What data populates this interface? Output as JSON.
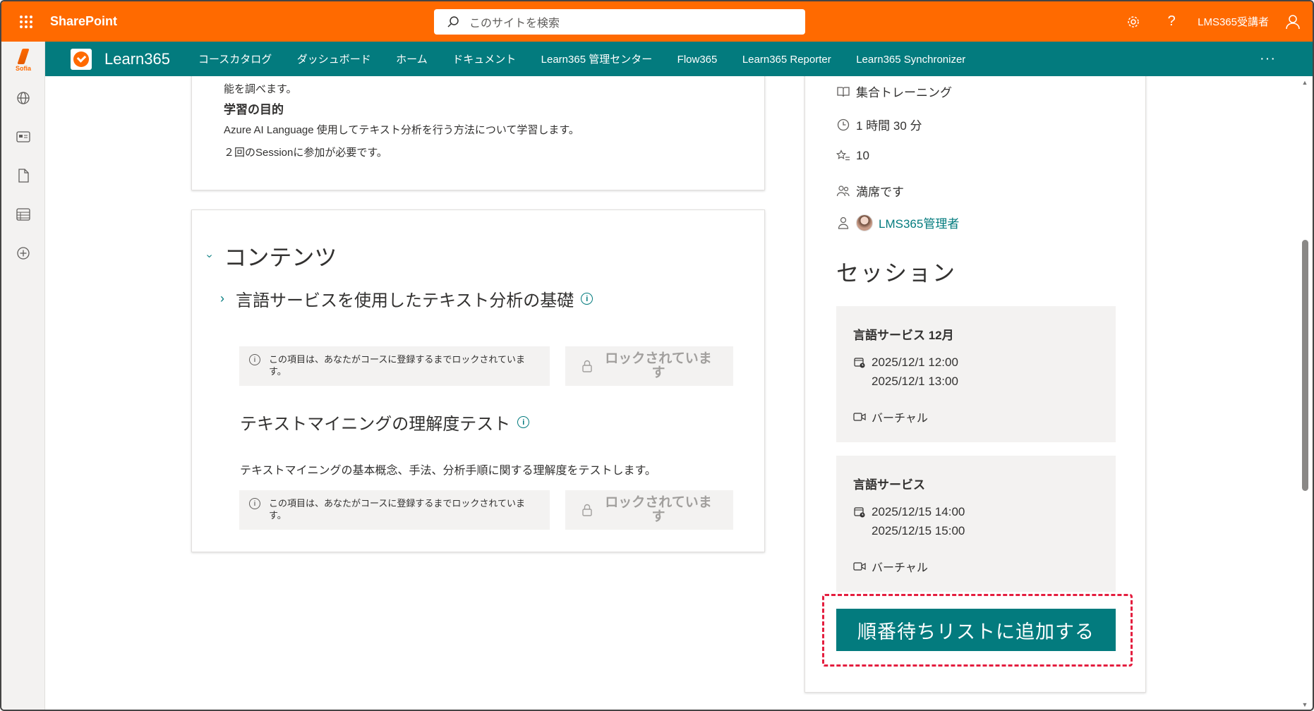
{
  "suite": {
    "app_name": "SharePoint",
    "search_placeholder": "このサイトを検索",
    "user_name": "LMS365受講者"
  },
  "rail": {
    "brand_text": "Sofia"
  },
  "site": {
    "title": "Learn365",
    "nav": [
      "コースカタログ",
      "ダッシュボード",
      "ホーム",
      "ドキュメント",
      "Learn365 管理センター",
      "Flow365",
      "Learn365 Reporter",
      "Learn365 Synchronizer"
    ],
    "more": "···"
  },
  "overview": {
    "intro_tail": "能を調べます。",
    "goal_heading": "学習の目的",
    "goal_text": "Azure AI Language 使用してテキスト分析を行う方法について学習します。",
    "goal_note": "２回のSessionに参加が必要です。"
  },
  "contents": {
    "heading": "コンテンツ",
    "items": [
      {
        "title": "言語サービスを使用したテキスト分析の基礎",
        "description": "",
        "lock_note": "この項目は、あなたがコースに登録するまでロックされています。",
        "lock_button": "ロックされています"
      },
      {
        "title": "テキストマイニングの理解度テスト",
        "description": "テキストマイニングの基本概念、手法、分析手順に関する理解度をテストします。",
        "lock_note": "この項目は、あなたがコースに登録するまでロックされています。",
        "lock_button": "ロックされています"
      }
    ]
  },
  "course_info": {
    "type": "集合トレーニング",
    "duration": "1 時間 30 分",
    "points": "10",
    "seats": "満席です",
    "owner": "LMS365管理者"
  },
  "sessions": {
    "heading": "セッション",
    "list": [
      {
        "title": "言語サービス 12月",
        "start": "2025/12/1 12:00",
        "end": "2025/12/1 13:00",
        "type": "バーチャル"
      },
      {
        "title": "言語サービス",
        "start": "2025/12/15 14:00",
        "end": "2025/12/15 15:00",
        "type": "バーチャル"
      }
    ],
    "waitlist_button": "順番待ちリストに追加する"
  },
  "colors": {
    "suite_bar": "#ff6a00",
    "site_header": "#037b7e",
    "primary_button": "#037b7e",
    "highlight": "#e41e3f"
  }
}
